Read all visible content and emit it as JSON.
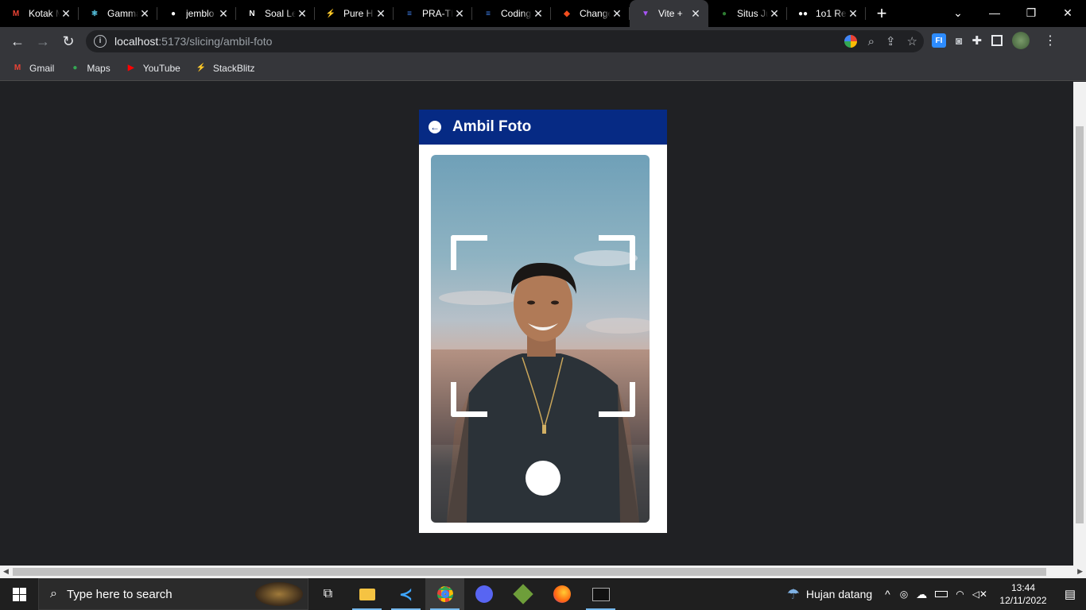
{
  "browser": {
    "tabs": [
      {
        "title": "Kotak Masuk",
        "icon": "gmail-icon",
        "color": "#ea4335",
        "glyph": "M"
      },
      {
        "title": "Gamma",
        "icon": "react-icon",
        "color": "#61dafb",
        "glyph": "⚛"
      },
      {
        "title": "jemblo",
        "icon": "github-icon",
        "color": "#ffffff",
        "glyph": "●"
      },
      {
        "title": "Soal Le",
        "icon": "notion-icon",
        "color": "#ffffff",
        "glyph": "N"
      },
      {
        "title": "Pure H",
        "icon": "stackblitz-icon",
        "color": "#1389fd",
        "glyph": "⚡"
      },
      {
        "title": "PRA-TI",
        "icon": "docs-icon",
        "color": "#4285f4",
        "glyph": "≡"
      },
      {
        "title": "Coding",
        "icon": "docs-icon",
        "color": "#4285f4",
        "glyph": "≡"
      },
      {
        "title": "Change",
        "icon": "figma-icon",
        "color": "#f24e1e",
        "glyph": "◆"
      },
      {
        "title": "Vite +",
        "icon": "vite-icon",
        "color": "#a855f7",
        "glyph": "▼",
        "active": true
      },
      {
        "title": "Situs Ju",
        "icon": "frog-icon",
        "color": "#2e7d32",
        "glyph": "●"
      },
      {
        "title": "1o1 Re",
        "icon": "medium-icon",
        "color": "#ffffff",
        "glyph": "●●"
      }
    ],
    "url_host": "localhost",
    "url_rest": ":5173/slicing/ambil-foto",
    "bookmarks": [
      {
        "label": "Gmail",
        "icon": "gmail-icon",
        "color": "#ea4335",
        "glyph": "M"
      },
      {
        "label": "Maps",
        "icon": "maps-icon",
        "color": "#34a853",
        "glyph": "●"
      },
      {
        "label": "YouTube",
        "icon": "youtube-icon",
        "color": "#ff0000",
        "glyph": "▶"
      },
      {
        "label": "StackBlitz",
        "icon": "stackblitz-icon",
        "color": "#1389fd",
        "glyph": "⚡"
      }
    ]
  },
  "app": {
    "title": "Ambil Foto",
    "header_color": "#062a84"
  },
  "taskbar": {
    "search_placeholder": "Type here to search",
    "weather": "Hujan datang",
    "time": "13:44",
    "date": "12/11/2022"
  }
}
